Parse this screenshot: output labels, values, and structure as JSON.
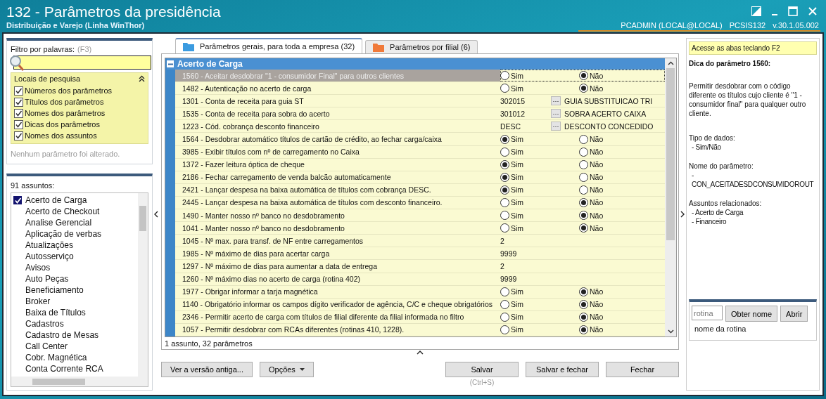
{
  "window": {
    "title": "132 - Parâmetros da presidência",
    "subtitle": "Distribuição e Varejo (Linha WinThor)",
    "user": "PCADMIN (LOCAL@LOCAL)",
    "program": "PCSIS132",
    "version": "v.30.1.05.002"
  },
  "filter": {
    "label": "Filtro por palavras:",
    "shortcut": "(F3)",
    "locations_title": "Locais de pesquisa",
    "expanded": true,
    "locations": [
      {
        "label": "Números dos parâmetros",
        "checked": true
      },
      {
        "label": "Títulos dos parâmetros",
        "checked": true
      },
      {
        "label": "Nomes dos parâmetros",
        "checked": true
      },
      {
        "label": "Dicas dos parâmetros",
        "checked": true
      },
      {
        "label": "Nomes dos assuntos",
        "checked": true
      }
    ],
    "status": "Nenhum parâmetro foi alterado."
  },
  "subjects": {
    "count_label": "91 assuntos:",
    "items": [
      {
        "label": "Acerto de Carga",
        "checked": true
      },
      {
        "label": "Acerto de Checkout",
        "checked": false
      },
      {
        "label": "Analise Gerencial",
        "checked": false
      },
      {
        "label": "Aplicação de verbas",
        "checked": false
      },
      {
        "label": "Atualizações",
        "checked": false
      },
      {
        "label": "Autosserviço",
        "checked": false
      },
      {
        "label": "Avisos",
        "checked": false
      },
      {
        "label": "Auto Peças",
        "checked": false
      },
      {
        "label": "Beneficiamento",
        "checked": false
      },
      {
        "label": "Broker",
        "checked": false
      },
      {
        "label": "Baixa de Títulos",
        "checked": false
      },
      {
        "label": "Cadastros",
        "checked": false
      },
      {
        "label": "Cadastro de Mesas",
        "checked": false
      },
      {
        "label": "Call Center",
        "checked": false
      },
      {
        "label": "Cobr. Magnética",
        "checked": false
      },
      {
        "label": "Conta Corrente RCA",
        "checked": false
      }
    ]
  },
  "tabs": [
    {
      "label": "Parâmetros gerais, para toda a empresa  (32)",
      "selected": true,
      "color": "#3b9be0"
    },
    {
      "label": "Parâmetros por filial  (6)",
      "selected": false,
      "color": "#f07a3a"
    }
  ],
  "grid": {
    "group": "Acerto de Carga",
    "expanded": true,
    "rows": [
      {
        "label": "1560 - Aceitar desdobrar \"1 - consumidor Final\" para outros clientes",
        "selected": true,
        "kind": "choice",
        "options": [
          {
            "label": "Sim",
            "selected": false
          },
          {
            "label": "Não",
            "selected": true
          }
        ]
      },
      {
        "label": "1482 - Autenticação no acerto de carga",
        "selected": false,
        "kind": "choice",
        "options": [
          {
            "label": "Sim",
            "selected": false
          },
          {
            "label": "Não",
            "selected": true
          }
        ]
      },
      {
        "label": "1301 - Conta de receita para guia ST",
        "selected": false,
        "kind": "lookup",
        "value": "302015",
        "button": "···",
        "description": "GUIA SUBSTITUICAO TRI"
      },
      {
        "label": "1535 - Conta de receita para sobra do acerto",
        "selected": false,
        "kind": "lookup",
        "value": "301012",
        "button": "···",
        "description": "SOBRA ACERTO CAIXA"
      },
      {
        "label": "1223 - Cód. cobrança desconto financeiro",
        "selected": false,
        "kind": "lookup",
        "value": "DESC",
        "button": "···",
        "description": "DESCONTO CONCEDIDO"
      },
      {
        "label": "1564 - Desdobrar automático títulos de cartão de crédito, ao fechar carga/caixa",
        "selected": false,
        "kind": "choice",
        "options": [
          {
            "label": "Sim",
            "selected": true
          },
          {
            "label": "Não",
            "selected": false
          }
        ]
      },
      {
        "label": "3985 - Exibir títulos com nº de carregamento no Caixa",
        "selected": false,
        "kind": "choice",
        "options": [
          {
            "label": "Sim",
            "selected": false
          },
          {
            "label": "Não",
            "selected": false
          }
        ]
      },
      {
        "label": "1372 - Fazer leitura óptica de cheque",
        "selected": false,
        "kind": "choice",
        "options": [
          {
            "label": "Sim",
            "selected": true
          },
          {
            "label": "Não",
            "selected": false
          }
        ]
      },
      {
        "label": "2186 - Fechar carregamento de venda balcão automaticamente",
        "selected": false,
        "kind": "choice",
        "options": [
          {
            "label": "Sim",
            "selected": true
          },
          {
            "label": "Não",
            "selected": false
          }
        ]
      },
      {
        "label": "2421 - Lançar despesa na baixa automática de títulos com cobrança DESC.",
        "selected": false,
        "kind": "choice",
        "options": [
          {
            "label": "Sim",
            "selected": true
          },
          {
            "label": "Não",
            "selected": false
          }
        ]
      },
      {
        "label": "2445 - Lançar despesa na baixa automática de títulos com desconto financeiro.",
        "selected": false,
        "kind": "choice",
        "options": [
          {
            "label": "Sim",
            "selected": false
          },
          {
            "label": "Não",
            "selected": true
          }
        ]
      },
      {
        "label": "1490 - Manter nosso nº banco no desdobramento",
        "selected": false,
        "kind": "choice",
        "options": [
          {
            "label": "Sim",
            "selected": false
          },
          {
            "label": "Não",
            "selected": true
          }
        ]
      },
      {
        "label": "1041 - Manter nosso nº banco no desdobramento",
        "selected": false,
        "kind": "choice",
        "options": [
          {
            "label": "Sim",
            "selected": false
          },
          {
            "label": "Não",
            "selected": true
          }
        ]
      },
      {
        "label": "1045 - Nº max. para transf. de NF entre carregamentos",
        "selected": false,
        "kind": "text",
        "value": "2"
      },
      {
        "label": "1985 - Nº máximo de dias para acertar carga",
        "selected": false,
        "kind": "text",
        "value": "9999"
      },
      {
        "label": "1297 - Nº máximo de dias para aumentar a data de entrega",
        "selected": false,
        "kind": "text",
        "value": "2"
      },
      {
        "label": "1260 - Nº máximo dias no acerto de carga (rotina 402)",
        "selected": false,
        "kind": "text",
        "value": "9999"
      },
      {
        "label": "1977 - Obrigar informar a tarja magnética",
        "selected": false,
        "kind": "choice",
        "options": [
          {
            "label": "Sim",
            "selected": false
          },
          {
            "label": "Não",
            "selected": true
          }
        ]
      },
      {
        "label": "1140 - Obrigatório informar os campos dígito verificador de agência, C/C e cheque obrigatórios",
        "selected": false,
        "kind": "choice",
        "options": [
          {
            "label": "Sim",
            "selected": false
          },
          {
            "label": "Não",
            "selected": true
          }
        ]
      },
      {
        "label": "2346 - Permitir acerto de carga com títulos de filial diferente da filial informada no filtro",
        "selected": false,
        "kind": "choice",
        "options": [
          {
            "label": "Sim",
            "selected": false
          },
          {
            "label": "Não",
            "selected": true
          }
        ]
      },
      {
        "label": "1057 - Permitir desdobrar com RCAs diferentes (rotinas 410, 1228).",
        "selected": false,
        "kind": "choice",
        "options": [
          {
            "label": "Sim",
            "selected": false
          },
          {
            "label": "Não",
            "selected": true
          }
        ]
      }
    ],
    "status": "1 assunto, 32 parâmetros"
  },
  "hint": {
    "banner": "Acesse as abas teclando F2",
    "title": "Dica do parâmetro 1560:",
    "text": "Permitir desdobrar com o código diferente os títulos cujo cliente é \"1 - consumidor final\" para qualquer outro cliente.",
    "sections": [
      {
        "heading": "Tipo de dados:",
        "lines": [
          "- Sim/Não"
        ]
      },
      {
        "heading": "Nome do parâmetro:",
        "lines": [
          "-",
          "CON_ACEITADESDCONSUMIDOROUT"
        ]
      },
      {
        "heading": "Assuntos relacionados:",
        "lines": [
          "- Acerto de Carga",
          "- Financeiro"
        ]
      }
    ]
  },
  "routine": {
    "placeholder": "rotina",
    "get_name_button": "Obter nome",
    "open_button": "Abrir",
    "name": "nome da rotina"
  },
  "buttons": {
    "old_version": "Ver a versão antiga...",
    "options": "Opções",
    "save": "Salvar",
    "save_shortcut": "(Ctrl+S)",
    "save_close": "Salvar e fechar",
    "close": "Fechar"
  }
}
